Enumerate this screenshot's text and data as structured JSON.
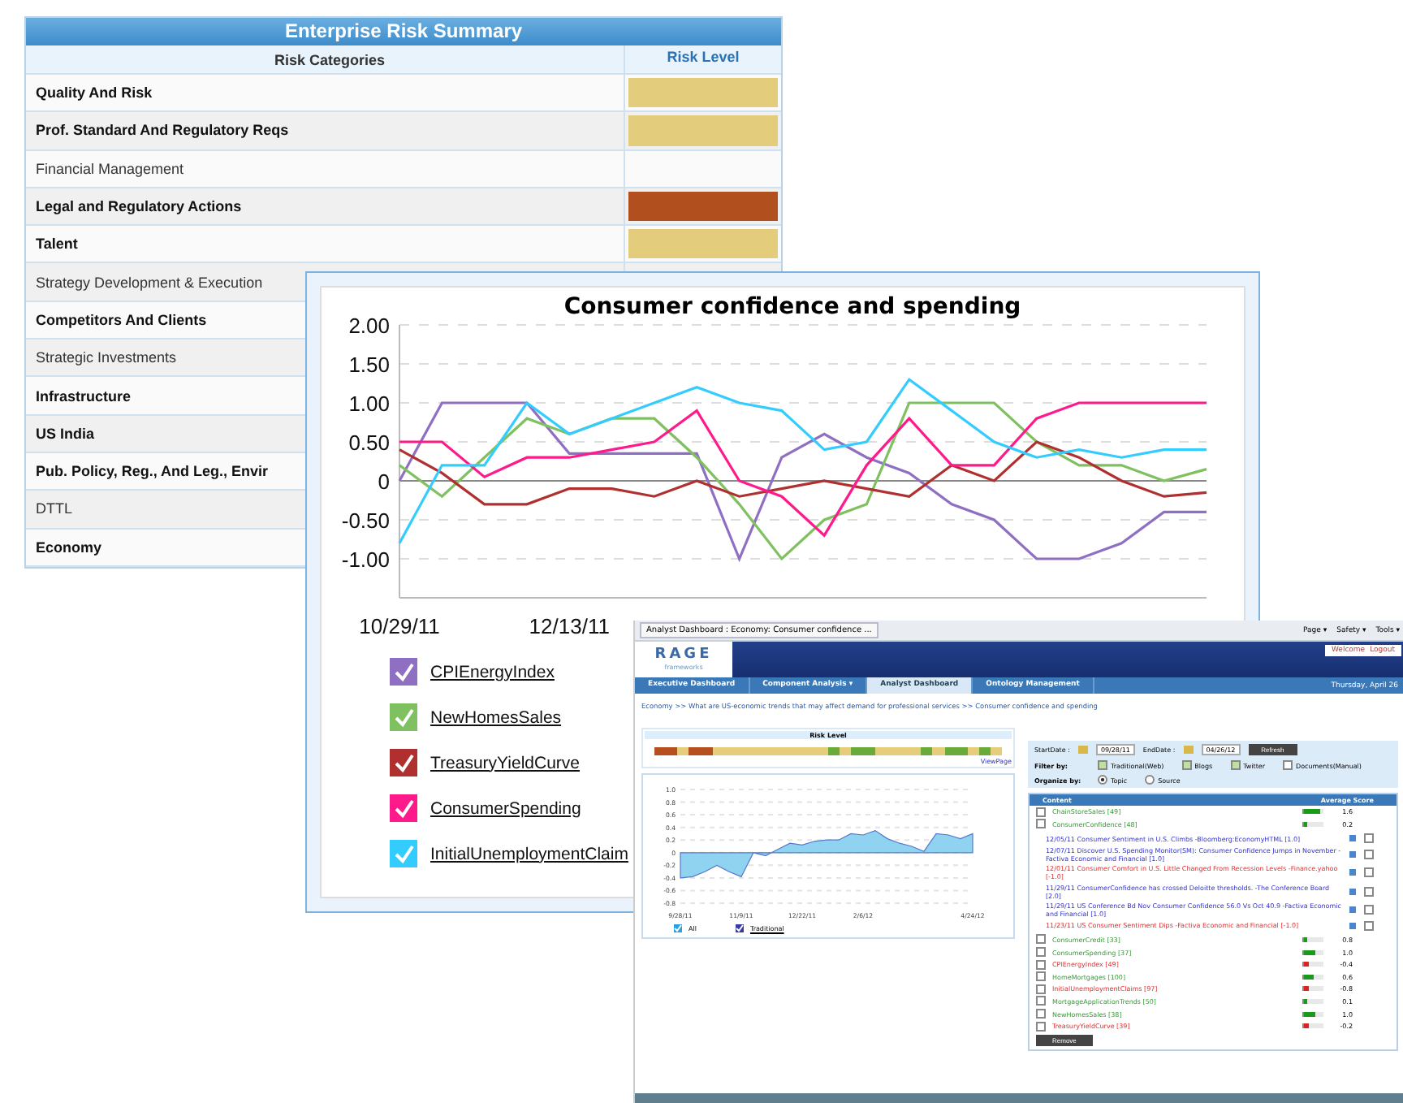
{
  "risk_table": {
    "title": "Enterprise Risk Summary",
    "columns": [
      "Risk Categories",
      "Risk Level"
    ],
    "rows": [
      {
        "name": "Quality And Risk",
        "bold": true,
        "color": "#e3cd7d"
      },
      {
        "name": "Prof. Standard And Regulatory Reqs",
        "bold": true,
        "color": "#e3cd7d"
      },
      {
        "name": "Financial Management",
        "bold": false
      },
      {
        "name": "Legal and Regulatory Actions",
        "bold": true,
        "color": "#b24f1f"
      },
      {
        "name": "Talent",
        "bold": true,
        "color": "#e3cd7d"
      },
      {
        "name": "Strategy Development & Execution",
        "bold": false
      },
      {
        "name": "Competitors And Clients",
        "bold": true
      },
      {
        "name": "Strategic Investments",
        "bold": false
      },
      {
        "name": "Infrastructure",
        "bold": true
      },
      {
        "name": "US India",
        "bold": true
      },
      {
        "name": "Pub. Policy, Reg., And Leg., Envir",
        "bold": true
      },
      {
        "name": "DTTL",
        "bold": false
      },
      {
        "name": "Economy",
        "bold": true
      }
    ]
  },
  "chart_window": {
    "chart_data": {
      "type": "line",
      "title": "Consumer confidence and spending",
      "grid": true,
      "legend": "bottom",
      "ylim": [
        -1.5,
        2
      ],
      "categories": [
        "10/29/11",
        null,
        null,
        null,
        "12/13/11",
        null,
        null,
        null,
        null,
        null,
        null,
        null,
        null,
        null,
        null,
        null,
        null,
        null,
        null,
        null
      ],
      "yticks": [
        {
          "value": 2,
          "label": "2.00"
        },
        {
          "value": 1.5,
          "label": "1.50"
        },
        {
          "value": 1,
          "label": "1.00"
        },
        {
          "value": 0.5,
          "label": "0.50"
        },
        {
          "value": 0,
          "label": "0"
        },
        {
          "value": -0.5,
          "label": "-0.50"
        },
        {
          "value": -1,
          "label": "-1.00"
        }
      ],
      "series": [
        {
          "name": "CPIEnergyIndex",
          "color": "#8e6fc1",
          "values": [
            0,
            1,
            1,
            1,
            0.35,
            0.35,
            0.35,
            0.35,
            -1,
            0.3,
            0.6,
            0.3,
            0.1,
            -0.3,
            -0.5,
            -1,
            -1,
            -0.8,
            -0.4,
            -0.4
          ]
        },
        {
          "name": "NewHomesSales",
          "color": "#7fc060",
          "values": [
            0.2,
            -0.2,
            0.3,
            0.8,
            0.6,
            0.8,
            0.8,
            0.3,
            -0.3,
            -1,
            -0.5,
            -0.3,
            1,
            1,
            1,
            0.5,
            0.2,
            0.2,
            0,
            0.15
          ]
        },
        {
          "name": "TreasuryYieldCurve",
          "color": "#b03030",
          "values": [
            0.4,
            0.1,
            -0.3,
            -0.3,
            -0.1,
            -0.1,
            -0.2,
            0,
            -0.2,
            -0.1,
            0,
            -0.1,
            -0.2,
            0.2,
            0,
            0.5,
            0.3,
            0,
            -0.2,
            -0.15
          ]
        },
        {
          "name": "ConsumerSpending",
          "color": "#ff1a8c",
          "values": [
            0.5,
            0.5,
            0.05,
            0.3,
            0.3,
            0.4,
            0.5,
            0.9,
            0,
            -0.2,
            -0.7,
            0.2,
            0.8,
            0.2,
            0.2,
            0.8,
            1,
            1,
            1,
            1
          ]
        },
        {
          "name": "InitialUnemploymentClaim",
          "color": "#33ccff",
          "values": [
            -0.8,
            0.2,
            0.2,
            1,
            0.6,
            0.8,
            1,
            1.2,
            1,
            0.9,
            0.4,
            0.5,
            1.3,
            0.9,
            0.5,
            0.3,
            0.4,
            0.3,
            0.4,
            0.4
          ]
        }
      ]
    },
    "legend": [
      {
        "checked": true
      },
      {
        "checked": true
      },
      {
        "checked": true
      },
      {
        "checked": true
      },
      {
        "checked": true
      }
    ]
  },
  "dashboard": {
    "browser_tab": "Analyst Dashboard : Economy: Consumer confidence ...",
    "browser_menu": [
      "Page ▾",
      "Safety ▾",
      "Tools ▾"
    ],
    "logo": {
      "name": "RAGE",
      "tagline": "frameworks"
    },
    "user_links": [
      "Welcome",
      "Logout"
    ],
    "nav": [
      {
        "label": "Executive Dashboard",
        "selected": false
      },
      {
        "label": "Component Analysis ▾",
        "selected": false
      },
      {
        "label": "Analyst Dashboard",
        "selected": true
      },
      {
        "label": "Ontology Management",
        "selected": false
      }
    ],
    "date": "Thursday, April 26",
    "breadcrumb": "Economy >> What are US-economic trends that may affect demand for professional services >> Consumer confidence and spending",
    "risk_level": {
      "title": "Risk Level",
      "link": "ViewPage",
      "segments": [
        {
          "color": "#b5501e"
        },
        {
          "color": "#b5501e"
        },
        {
          "color": "#e6cd7b"
        },
        {
          "color": "#b5501e"
        },
        {
          "color": "#b5501e"
        },
        {
          "color": "#e6cd7b"
        },
        {
          "color": "#e6cd7b"
        },
        {
          "color": "#e6cd7b"
        },
        {
          "color": "#e6cd7b"
        },
        {
          "color": "#e6cd7b"
        },
        {
          "color": "#e6cd7b"
        },
        {
          "color": "#e6cd7b"
        },
        {
          "color": "#e6cd7b"
        },
        {
          "color": "#e6cd7b"
        },
        {
          "color": "#e6cd7b"
        },
        {
          "color": "#6aaa3a"
        },
        {
          "color": "#e6cd7b"
        },
        {
          "color": "#6aaa3a"
        },
        {
          "color": "#6aaa3a"
        },
        {
          "color": "#e6cd7b"
        },
        {
          "color": "#e6cd7b"
        },
        {
          "color": "#e6cd7b"
        },
        {
          "color": "#e6cd7b"
        },
        {
          "color": "#6aaa3a"
        },
        {
          "color": "#e6cd7b"
        },
        {
          "color": "#6aaa3a"
        },
        {
          "color": "#6aaa3a"
        },
        {
          "color": "#e6cd7b"
        },
        {
          "color": "#6aaa3a"
        },
        {
          "color": "#e6cd7b"
        }
      ]
    },
    "chart_data": {
      "type": "area",
      "grid": true,
      "legend": "bottom",
      "ylim": [
        -0.8,
        1
      ],
      "categories": [
        "9/28/11",
        null,
        null,
        null,
        null,
        "11/9/11",
        null,
        null,
        null,
        null,
        "12/22/11",
        null,
        null,
        null,
        null,
        "2/6/12",
        null,
        null,
        null,
        null,
        null,
        null,
        null,
        null,
        "4/24/12"
      ],
      "yticks": [
        {
          "value": 1,
          "label": "1.0"
        },
        {
          "value": 0.8,
          "label": "0.8"
        },
        {
          "value": 0.6,
          "label": "0.6"
        },
        {
          "value": 0.4,
          "label": "0.4"
        },
        {
          "value": 0.2,
          "label": "0.2"
        },
        {
          "value": 0,
          "label": "0"
        },
        {
          "value": -0.2,
          "label": "-0.2"
        },
        {
          "value": -0.4,
          "label": "-0.4"
        },
        {
          "value": -0.6,
          "label": "-0.6"
        },
        {
          "value": -0.8,
          "label": "-0.8"
        }
      ],
      "series": [
        {
          "name": "All",
          "color": "#8fd3f0",
          "values": [
            -0.4,
            -0.38,
            -0.3,
            -0.2,
            -0.3,
            -0.38,
            0,
            -0.05,
            0.05,
            0.15,
            0.12,
            0.18,
            0.2,
            0.2,
            0.3,
            0.28,
            0.35,
            0.22,
            0.15,
            0.1,
            0.02,
            0.3,
            0.28,
            0.22,
            0.3
          ]
        }
      ]
    },
    "chart_legend": [
      {
        "checked": true,
        "color": "#2ba0e0"
      },
      {
        "label": "Traditional",
        "checked": true,
        "color": "#3a3aa0"
      }
    ],
    "start_label": "StartDate :",
    "start_value": "09/28/11",
    "end_label": "EndDate :",
    "end_value": "04/26/12",
    "refresh": "Refresh",
    "filter_label": "Filter by:",
    "filters": [
      {
        "label": "Traditional(Web)",
        "checked": true
      },
      {
        "label": "Blogs",
        "checked": true
      },
      {
        "label": "Twitter",
        "checked": true
      },
      {
        "label": "Documents(Manual)",
        "checked": false
      }
    ],
    "organize_label": "Organize by:",
    "organize": [
      {
        "label": "Topic",
        "selected": true
      },
      {
        "label": "Source",
        "selected": false
      }
    ],
    "table_columns": [
      "Content",
      "Average Score"
    ],
    "rows": [
      {
        "name": "ChainStoreSales [49]",
        "score": "1.6",
        "level": 0.8,
        "negative": false,
        "checked": false
      },
      {
        "name": "ConsumerConfidence [48]",
        "score": "0.2",
        "level": 0.2,
        "negative": false,
        "checked": false
      }
    ],
    "articles": [
      {
        "date": "12/05/11",
        "text": "Consumer Sentiment in U.S. Climbs -Bloomberg:EconomyHTML [1.0]",
        "negative": false,
        "checked": false
      },
      {
        "date": "12/07/11",
        "text": "Discover U.S. Spending Monitor(SM): Consumer Confidence Jumps in November -Factiva Economic and Financial [1.0]",
        "negative": false,
        "checked": false
      },
      {
        "date": "12/01/11",
        "text": "Consumer Comfort in U.S. Little Changed From Recession Levels -Finance.yahoo [-1.0]",
        "negative": true,
        "checked": false
      },
      {
        "date": "11/29/11",
        "text": "ConsumerConfidence has crossed Deloitte thresholds. -The Conference Board [2.0]",
        "negative": false,
        "checked": false
      },
      {
        "date": "11/29/11",
        "text": "US Conference Bd Nov Consumer Confidence 56.0 Vs Oct 40.9 -Factiva Economic and Financial [1.0]",
        "negative": false,
        "checked": false
      },
      {
        "date": "11/23/11",
        "text": "US Consumer Sentiment Dips -Factiva Economic and Financial [-1.0]",
        "negative": true,
        "checked": false
      }
    ],
    "rows_after": [
      {
        "name": "ConsumerCredit [33]",
        "score": "0.8",
        "level": 0.2,
        "negative": false,
        "checked": false
      },
      {
        "name": "ConsumerSpending [37]",
        "score": "1.0",
        "level": 0.6,
        "negative": false,
        "checked": false
      },
      {
        "name": "CPIEnergyIndex [49]",
        "score": "-0.4",
        "level": 0.25,
        "negative": true,
        "checked": false
      },
      {
        "name": "HomeMortgages [100]",
        "score": "0.6",
        "level": 0.5,
        "negative": false,
        "checked": false
      },
      {
        "name": "InitialUnemploymentClaims [97]",
        "score": "-0.8",
        "level": 0.25,
        "negative": true,
        "checked": false
      },
      {
        "name": "MortgageApplicationTrends [50]",
        "score": "0.1",
        "level": 0.2,
        "negative": false,
        "checked": false
      },
      {
        "name": "NewHomesSales [38]",
        "score": "1.0",
        "level": 0.6,
        "negative": false,
        "checked": false
      },
      {
        "name": "TreasuryYieldCurve [39]",
        "score": "-0.2",
        "level": 0.25,
        "negative": true,
        "checked": false
      }
    ],
    "remove": "Remove"
  }
}
